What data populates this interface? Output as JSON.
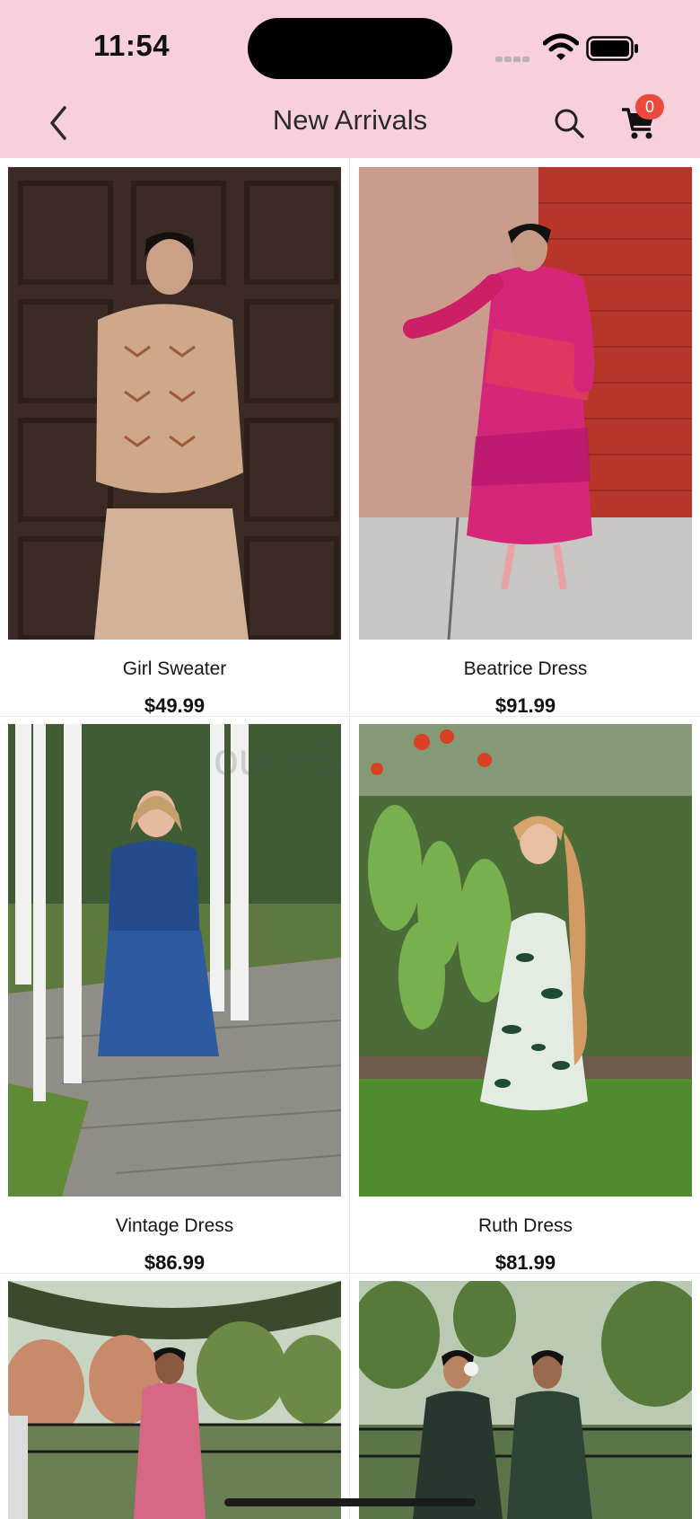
{
  "status": {
    "time": "11:54"
  },
  "nav": {
    "title": "New Arrivals",
    "cart_count": "0"
  },
  "watermark": "ourieS",
  "products": [
    {
      "name": "Girl Sweater",
      "price": "$49.99"
    },
    {
      "name": "Beatrice Dress",
      "price": "$91.99"
    },
    {
      "name": "Vintage Dress",
      "price": "$86.99"
    },
    {
      "name": "Ruth Dress",
      "price": "$81.99"
    },
    {
      "name": "",
      "price": ""
    },
    {
      "name": "",
      "price": ""
    }
  ],
  "colors": {
    "header_bg": "#f8d0dc",
    "badge": "#ec4a3c"
  },
  "icons": [
    "back-chevron-icon",
    "search-icon",
    "cart-icon",
    "wifi-icon",
    "battery-icon",
    "signal-icon"
  ]
}
